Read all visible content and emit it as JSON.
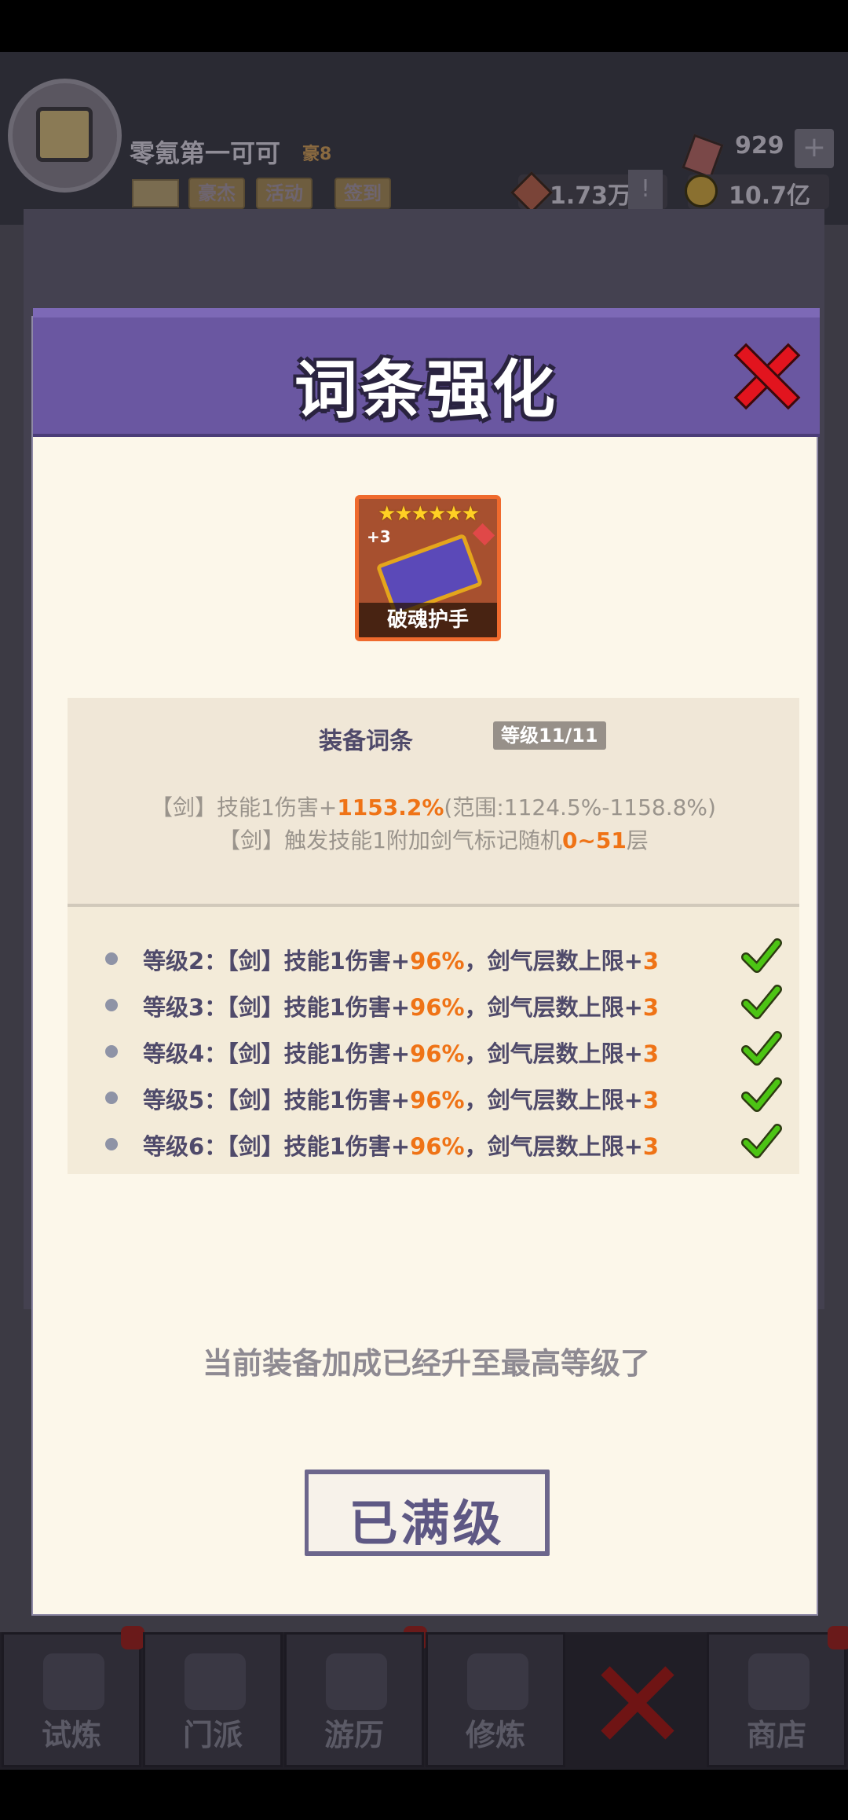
{
  "player": {
    "name": "零氪第一可可",
    "badge": "豪8",
    "buttons": [
      "豪杰",
      "活动",
      "签到"
    ],
    "gems": "929",
    "power": "1.73万",
    "coins": "10.7亿"
  },
  "bottom_nav": {
    "tabs": [
      "试炼",
      "门派",
      "游历",
      "修炼",
      "",
      "商店"
    ]
  },
  "modal": {
    "title": "词条强化",
    "item": {
      "name": "破魂护手",
      "level": "+3",
      "stars": "★★★★★★"
    },
    "affix": {
      "title": "装备词条",
      "level": "等级11/11",
      "line1": {
        "prefix": "【剑】技能1伤害+",
        "value": "1153.2%",
        "suffix": "(范围:1124.5%-1158.8%)"
      },
      "line2": {
        "prefix": "【剑】触发技能1附加剑气标记随机",
        "value": "0~51",
        "suffix": "层"
      }
    },
    "levels": [
      {
        "label": "等级2：【剑】技能1伤害+",
        "value1": "96%",
        "mid": "，剑气层数上限+",
        "value2": "3",
        "done": true
      },
      {
        "label": "等级3：【剑】技能1伤害+",
        "value1": "96%",
        "mid": "，剑气层数上限+",
        "value2": "3",
        "done": true
      },
      {
        "label": "等级4：【剑】技能1伤害+",
        "value1": "96%",
        "mid": "，剑气层数上限+",
        "value2": "3",
        "done": true
      },
      {
        "label": "等级5：【剑】技能1伤害+",
        "value1": "96%",
        "mid": "，剑气层数上限+",
        "value2": "3",
        "done": true
      },
      {
        "label": "等级6：【剑】技能1伤害+",
        "value1": "96%",
        "mid": "，剑气层数上限+",
        "value2": "3",
        "done": true
      }
    ],
    "max_note": "当前装备加成已经升至最高等级了",
    "max_button": "已满级"
  },
  "colors": {
    "header": "#6a57a1",
    "accent": "#ef7316",
    "close": "#e2141e",
    "check": "#4cc414"
  }
}
